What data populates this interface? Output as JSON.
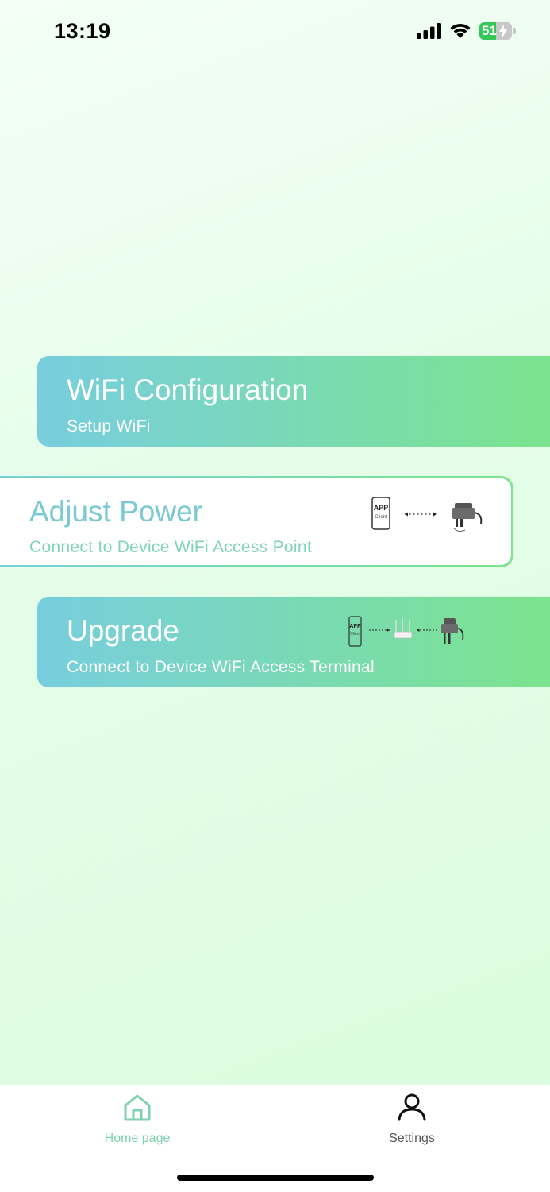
{
  "status_bar": {
    "time": "13:19",
    "battery_level": "51",
    "battery_fraction": 0.51,
    "signal_icon": "cellular-signal-icon",
    "wifi_icon": "wifi-icon",
    "battery_icon": "battery-charging-icon"
  },
  "cards": [
    {
      "title": "WiFi Configuration",
      "subtitle": "Setup WiFi"
    },
    {
      "title": "Adjust Power",
      "subtitle": "Connect to Device WiFi Access Point"
    },
    {
      "title": "Upgrade",
      "subtitle": "Connect to Device WiFi Access Terminal"
    }
  ],
  "illustrations": {
    "app_label": "APP",
    "client_label": "Client"
  },
  "tabbar": {
    "home_label": "Home page",
    "settings_label": "Settings",
    "home_icon": "home-icon",
    "settings_icon": "user-icon"
  },
  "colors": {
    "card_gradient_start": "#78cede",
    "card_gradient_end": "#7ce48c",
    "active_tab": "#7fd1b0",
    "battery_green": "#34c759"
  }
}
